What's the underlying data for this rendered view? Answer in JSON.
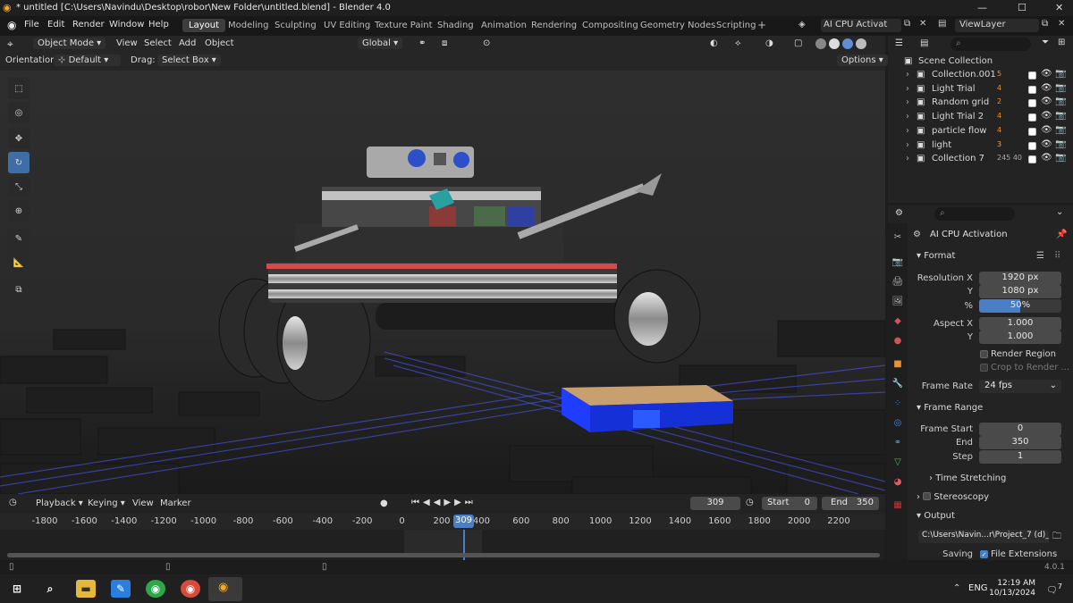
{
  "title": "* untitled [C:\\Users\\Navindu\\Desktop\\robor\\New Folder\\untitled.blend] - Blender 4.0",
  "menu": [
    "File",
    "Edit",
    "Render",
    "Window",
    "Help"
  ],
  "workspaces": [
    "Layout",
    "Modeling",
    "Sculpting",
    "UV Editing",
    "Texture Paint",
    "Shading",
    "Animation",
    "Rendering",
    "Compositing",
    "Geometry Nodes",
    "Scripting"
  ],
  "active_workspace": "Layout",
  "scene_name": "AI CPU Activat",
  "view_layer": "ViewLayer",
  "header3d": {
    "mode": "Object Mode",
    "view": "View",
    "select": "Select",
    "add": "Add",
    "object": "Object",
    "transform": "Global"
  },
  "toolsettings": {
    "orientation_label": "Orientation:",
    "orientation": "Default",
    "drag_label": "Drag:",
    "drag": "Select Box",
    "options": "Options"
  },
  "outliner": {
    "root": "Scene Collection",
    "items": [
      {
        "name": "Collection.001",
        "count": "5"
      },
      {
        "name": "Light Trial",
        "count": "4"
      },
      {
        "name": "Random grid",
        "count": "2"
      },
      {
        "name": "Light Trial 2",
        "count": "4"
      },
      {
        "name": "particle flow",
        "count": "4"
      },
      {
        "name": "light",
        "count": "3"
      },
      {
        "name": "Collection 7",
        "count": "245 40"
      }
    ]
  },
  "properties": {
    "scene": "AI CPU Activation",
    "format_header": "Format",
    "res_x_label": "Resolution X",
    "res_x": "1920 px",
    "res_y_label": "Y",
    "res_y": "1080 px",
    "pct_label": "%",
    "pct": "50%",
    "pct_value": 0.5,
    "aspect_x_label": "Aspect X",
    "aspect_x": "1.000",
    "aspect_y_label": "Y",
    "aspect_y": "1.000",
    "render_region": "Render Region",
    "crop": "Crop to Render ...",
    "frame_rate_label": "Frame Rate",
    "frame_rate": "24 fps",
    "frame_range_header": "Frame Range",
    "frame_start_label": "Frame Start",
    "frame_start": "0",
    "end_label": "End",
    "end": "350",
    "step_label": "Step",
    "step": "1",
    "time_stretching": "Time Stretching",
    "stereoscopy": "Stereoscopy",
    "output_header": "Output",
    "output_path": "C:\\Users\\Navin...r\\Project_7 (d)_",
    "saving_label": "Saving",
    "file_ext": "File Extensions"
  },
  "timeline": {
    "playback": "Playback",
    "keying": "Keying",
    "view": "View",
    "marker": "Marker",
    "current": "309",
    "start_label": "Start",
    "start": "0",
    "end_label": "End",
    "end": "350",
    "ticks": [
      "-1800",
      "-1600",
      "-1400",
      "-1200",
      "-1000",
      "-800",
      "-600",
      "-400",
      "-200",
      "0",
      "200",
      "400",
      "600",
      "800",
      "1000",
      "1200",
      "1400",
      "1600",
      "1800",
      "2000",
      "2200"
    ]
  },
  "status": {
    "version": "4.0.1"
  },
  "taskbar": {
    "lang": "ENG",
    "time": "12:19 AM",
    "date": "10/13/2024",
    "notif": "7"
  }
}
